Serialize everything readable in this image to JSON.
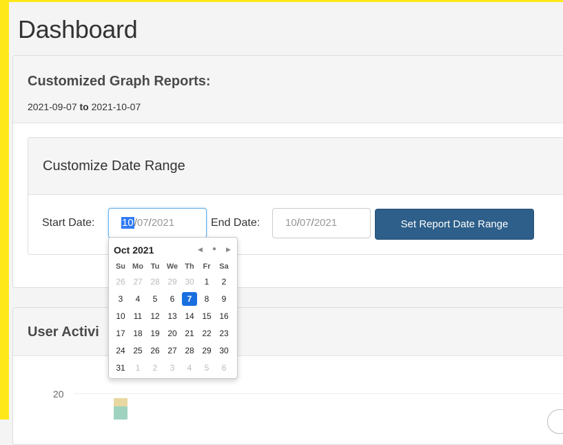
{
  "page": {
    "title": "Dashboard"
  },
  "report": {
    "title": "Customized Graph Reports:",
    "start": "2021-09-07",
    "to": "to",
    "end": "2021-10-07"
  },
  "range_panel": {
    "title": "Customize Date Range",
    "start_label": "Start Date:",
    "end_label": "End Date:",
    "start_month": "10",
    "start_day": "07",
    "start_year": "2021",
    "end_month": "10",
    "end_day": "07",
    "end_year": "2021",
    "sep": "/",
    "button_label": "Set Report Date Range"
  },
  "calendar": {
    "month_label": "Oct 2021",
    "prev_icon": "◀",
    "today_icon": "●",
    "next_icon": "▶",
    "weekdays": [
      "Su",
      "Mo",
      "Tu",
      "We",
      "Th",
      "Fr",
      "Sa"
    ],
    "days": [
      {
        "d": "26",
        "muted": true
      },
      {
        "d": "27",
        "muted": true
      },
      {
        "d": "28",
        "muted": true
      },
      {
        "d": "29",
        "muted": true
      },
      {
        "d": "30",
        "muted": true
      },
      {
        "d": "1"
      },
      {
        "d": "2"
      },
      {
        "d": "3"
      },
      {
        "d": "4"
      },
      {
        "d": "5"
      },
      {
        "d": "6"
      },
      {
        "d": "7",
        "selected": true
      },
      {
        "d": "8"
      },
      {
        "d": "9"
      },
      {
        "d": "10"
      },
      {
        "d": "11"
      },
      {
        "d": "12"
      },
      {
        "d": "13"
      },
      {
        "d": "14"
      },
      {
        "d": "15"
      },
      {
        "d": "16"
      },
      {
        "d": "17"
      },
      {
        "d": "18"
      },
      {
        "d": "19"
      },
      {
        "d": "20"
      },
      {
        "d": "21"
      },
      {
        "d": "22"
      },
      {
        "d": "23"
      },
      {
        "d": "24"
      },
      {
        "d": "25"
      },
      {
        "d": "26"
      },
      {
        "d": "27"
      },
      {
        "d": "28"
      },
      {
        "d": "29"
      },
      {
        "d": "30"
      },
      {
        "d": "31"
      },
      {
        "d": "1",
        "muted": true
      },
      {
        "d": "2",
        "muted": true
      },
      {
        "d": "3",
        "muted": true
      },
      {
        "d": "4",
        "muted": true
      },
      {
        "d": "5",
        "muted": true
      },
      {
        "d": "6",
        "muted": true
      }
    ]
  },
  "activity": {
    "title": "User Activi",
    "y_tick": "20"
  },
  "colors": {
    "accent_yellow": "#ffe81a",
    "primary_button": "#2e5f8a",
    "selected_day": "#1a6fe0"
  }
}
